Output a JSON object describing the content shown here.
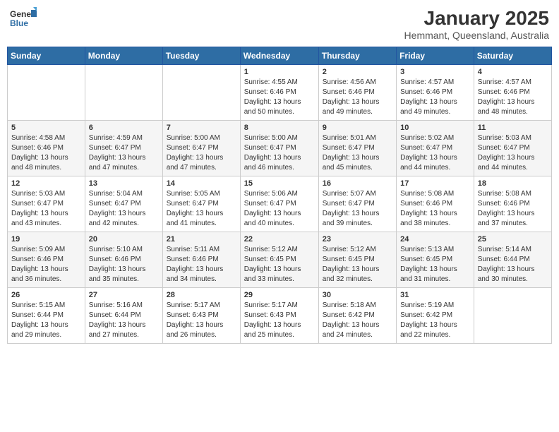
{
  "header": {
    "logo_general": "General",
    "logo_blue": "Blue",
    "title": "January 2025",
    "subtitle": "Hemmant, Queensland, Australia"
  },
  "days_of_week": [
    "Sunday",
    "Monday",
    "Tuesday",
    "Wednesday",
    "Thursday",
    "Friday",
    "Saturday"
  ],
  "weeks": [
    [
      {
        "day": "",
        "info": ""
      },
      {
        "day": "",
        "info": ""
      },
      {
        "day": "",
        "info": ""
      },
      {
        "day": "1",
        "info": "Sunrise: 4:55 AM\nSunset: 6:46 PM\nDaylight: 13 hours\nand 50 minutes."
      },
      {
        "day": "2",
        "info": "Sunrise: 4:56 AM\nSunset: 6:46 PM\nDaylight: 13 hours\nand 49 minutes."
      },
      {
        "day": "3",
        "info": "Sunrise: 4:57 AM\nSunset: 6:46 PM\nDaylight: 13 hours\nand 49 minutes."
      },
      {
        "day": "4",
        "info": "Sunrise: 4:57 AM\nSunset: 6:46 PM\nDaylight: 13 hours\nand 48 minutes."
      }
    ],
    [
      {
        "day": "5",
        "info": "Sunrise: 4:58 AM\nSunset: 6:46 PM\nDaylight: 13 hours\nand 48 minutes."
      },
      {
        "day": "6",
        "info": "Sunrise: 4:59 AM\nSunset: 6:47 PM\nDaylight: 13 hours\nand 47 minutes."
      },
      {
        "day": "7",
        "info": "Sunrise: 5:00 AM\nSunset: 6:47 PM\nDaylight: 13 hours\nand 47 minutes."
      },
      {
        "day": "8",
        "info": "Sunrise: 5:00 AM\nSunset: 6:47 PM\nDaylight: 13 hours\nand 46 minutes."
      },
      {
        "day": "9",
        "info": "Sunrise: 5:01 AM\nSunset: 6:47 PM\nDaylight: 13 hours\nand 45 minutes."
      },
      {
        "day": "10",
        "info": "Sunrise: 5:02 AM\nSunset: 6:47 PM\nDaylight: 13 hours\nand 44 minutes."
      },
      {
        "day": "11",
        "info": "Sunrise: 5:03 AM\nSunset: 6:47 PM\nDaylight: 13 hours\nand 44 minutes."
      }
    ],
    [
      {
        "day": "12",
        "info": "Sunrise: 5:03 AM\nSunset: 6:47 PM\nDaylight: 13 hours\nand 43 minutes."
      },
      {
        "day": "13",
        "info": "Sunrise: 5:04 AM\nSunset: 6:47 PM\nDaylight: 13 hours\nand 42 minutes."
      },
      {
        "day": "14",
        "info": "Sunrise: 5:05 AM\nSunset: 6:47 PM\nDaylight: 13 hours\nand 41 minutes."
      },
      {
        "day": "15",
        "info": "Sunrise: 5:06 AM\nSunset: 6:47 PM\nDaylight: 13 hours\nand 40 minutes."
      },
      {
        "day": "16",
        "info": "Sunrise: 5:07 AM\nSunset: 6:47 PM\nDaylight: 13 hours\nand 39 minutes."
      },
      {
        "day": "17",
        "info": "Sunrise: 5:08 AM\nSunset: 6:46 PM\nDaylight: 13 hours\nand 38 minutes."
      },
      {
        "day": "18",
        "info": "Sunrise: 5:08 AM\nSunset: 6:46 PM\nDaylight: 13 hours\nand 37 minutes."
      }
    ],
    [
      {
        "day": "19",
        "info": "Sunrise: 5:09 AM\nSunset: 6:46 PM\nDaylight: 13 hours\nand 36 minutes."
      },
      {
        "day": "20",
        "info": "Sunrise: 5:10 AM\nSunset: 6:46 PM\nDaylight: 13 hours\nand 35 minutes."
      },
      {
        "day": "21",
        "info": "Sunrise: 5:11 AM\nSunset: 6:46 PM\nDaylight: 13 hours\nand 34 minutes."
      },
      {
        "day": "22",
        "info": "Sunrise: 5:12 AM\nSunset: 6:45 PM\nDaylight: 13 hours\nand 33 minutes."
      },
      {
        "day": "23",
        "info": "Sunrise: 5:12 AM\nSunset: 6:45 PM\nDaylight: 13 hours\nand 32 minutes."
      },
      {
        "day": "24",
        "info": "Sunrise: 5:13 AM\nSunset: 6:45 PM\nDaylight: 13 hours\nand 31 minutes."
      },
      {
        "day": "25",
        "info": "Sunrise: 5:14 AM\nSunset: 6:44 PM\nDaylight: 13 hours\nand 30 minutes."
      }
    ],
    [
      {
        "day": "26",
        "info": "Sunrise: 5:15 AM\nSunset: 6:44 PM\nDaylight: 13 hours\nand 29 minutes."
      },
      {
        "day": "27",
        "info": "Sunrise: 5:16 AM\nSunset: 6:44 PM\nDaylight: 13 hours\nand 27 minutes."
      },
      {
        "day": "28",
        "info": "Sunrise: 5:17 AM\nSunset: 6:43 PM\nDaylight: 13 hours\nand 26 minutes."
      },
      {
        "day": "29",
        "info": "Sunrise: 5:17 AM\nSunset: 6:43 PM\nDaylight: 13 hours\nand 25 minutes."
      },
      {
        "day": "30",
        "info": "Sunrise: 5:18 AM\nSunset: 6:42 PM\nDaylight: 13 hours\nand 24 minutes."
      },
      {
        "day": "31",
        "info": "Sunrise: 5:19 AM\nSunset: 6:42 PM\nDaylight: 13 hours\nand 22 minutes."
      },
      {
        "day": "",
        "info": ""
      }
    ]
  ]
}
